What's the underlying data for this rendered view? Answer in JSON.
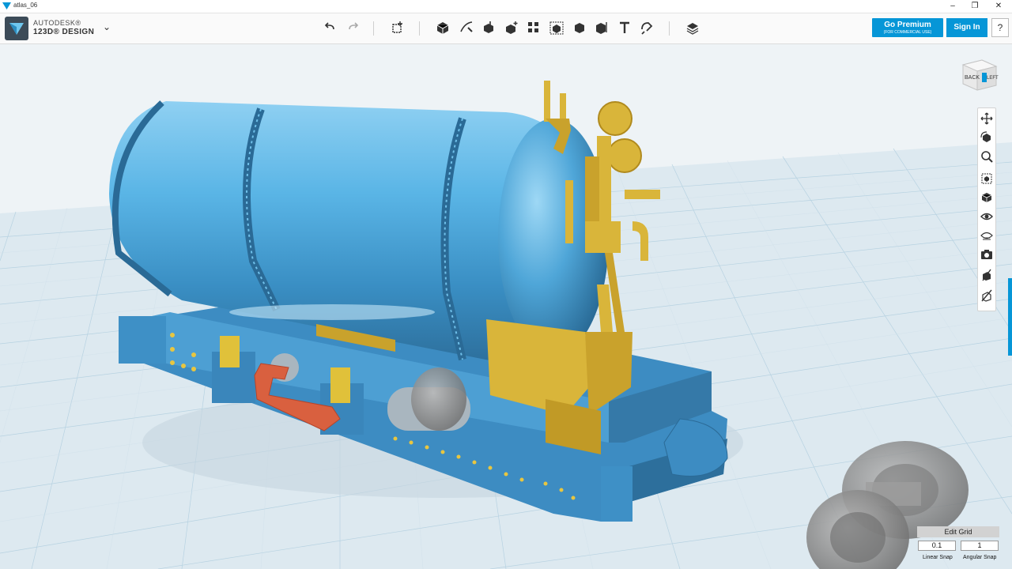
{
  "window": {
    "title": "atlas_06",
    "minimize": "–",
    "maximize": "❐",
    "close": "✕"
  },
  "brand": {
    "line1": "AUTODESK®",
    "line2": "123D® DESIGN"
  },
  "toolbar": {
    "tools": [
      "undo-icon",
      "redo-icon",
      "transform-icon",
      "primitives-icon",
      "sketch-icon",
      "construct-icon",
      "modify-icon",
      "pattern-icon",
      "grouping-icon",
      "combine-icon",
      "measure-icon",
      "text-icon",
      "snap-icon",
      "material-icon"
    ]
  },
  "account": {
    "premium_label": "Go Premium",
    "premium_sub": "(FOR COMMERCIAL USE)",
    "signin_label": "Sign In",
    "help_label": "?"
  },
  "viewcube": {
    "face_front": "BACK",
    "face_side": "LEFT"
  },
  "navbar": {
    "items": [
      "pan-icon",
      "orbit-icon",
      "zoom-icon",
      "fit-icon",
      "view-icon",
      "visibility-icon",
      "materials-outlines-icon",
      "camera-icon",
      "show-hide-icon",
      "hide-all-icon"
    ]
  },
  "grid": {
    "title": "Edit Grid",
    "linear_snap_value": "0.1",
    "angular_snap_value": "1",
    "linear_snap_label": "Linear Snap",
    "angular_snap_label": "Angular Snap"
  },
  "colors": {
    "accent": "#0696d7",
    "model_blue": "#4aa3d6",
    "model_gold": "#d9b53a",
    "model_red": "#d9603f",
    "grid_bg": "#eef3f6"
  }
}
